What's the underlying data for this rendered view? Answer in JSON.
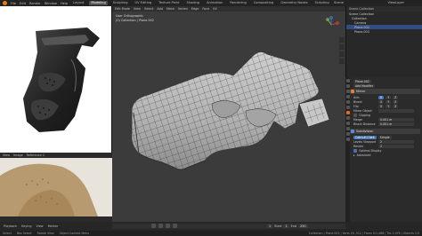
{
  "topbar": {
    "menus": [
      "File",
      "Edit",
      "Render",
      "Window",
      "Help"
    ],
    "workspaces": [
      "Layout",
      "Modeling",
      "Sculpting",
      "UV Editing",
      "Texture Paint",
      "Shading",
      "Animation",
      "Rendering",
      "Compositing",
      "Geometry Nodes",
      "Scripting"
    ],
    "active_workspace": "Modeling",
    "scene_label": "Scene",
    "viewlayer_label": "ViewLayer"
  },
  "ref_panel_bottom": {
    "header_items": [
      "View",
      "Image",
      "Reference 2"
    ]
  },
  "viewport": {
    "header_items": [
      "Edit Mode",
      "View",
      "Select",
      "Add",
      "Mesh",
      "Vertex",
      "Edge",
      "Face",
      "UV"
    ],
    "info_line1": "User Orthographic",
    "info_line2": "(0) Collection | Plane.002",
    "gizmo_axes": [
      "X",
      "Y",
      "Z"
    ]
  },
  "outliner": {
    "header": "Scene Collection",
    "rows": [
      {
        "label": "Scene Collection",
        "selected": false
      },
      {
        "label": "Collection",
        "selected": false
      },
      {
        "label": "Camera",
        "selected": false
      },
      {
        "label": "Plane.002",
        "selected": true
      },
      {
        "label": "Plane.003",
        "selected": false
      }
    ]
  },
  "properties": {
    "object_name": "Plane.002",
    "add_modifier_label": "Add Modifier",
    "modifiers": [
      {
        "name": "Mirror",
        "fields": [
          {
            "label": "Axis",
            "values": [
              "X",
              "Y",
              "Z"
            ]
          },
          {
            "label": "Bisect",
            "values": [
              "X",
              "Y",
              "Z"
            ]
          },
          {
            "label": "Flip",
            "values": [
              "X",
              "Y",
              "Z"
            ]
          },
          {
            "label": "Mirror Object",
            "values": [
              ""
            ]
          },
          {
            "label": "Clipping",
            "values": [
              ""
            ]
          },
          {
            "label": "Merge",
            "values": [
              "0.001 m"
            ]
          },
          {
            "label": "Bisect Distance",
            "values": [
              "0.001 m"
            ]
          }
        ]
      },
      {
        "name": "Subdivision",
        "mode_labels": [
          "Catmull-Clark",
          "Simple"
        ],
        "fields": [
          {
            "label": "Levels Viewport",
            "values": [
              "2"
            ]
          },
          {
            "label": "Render",
            "values": [
              "2"
            ]
          },
          {
            "label": "Optimal Display",
            "values": [
              ""
            ]
          }
        ],
        "advanced_label": "Advanced"
      }
    ]
  },
  "timeline": {
    "items": [
      "Playback",
      "Keying",
      "View",
      "Marker"
    ],
    "start_label": "Start",
    "start_value": "1",
    "end_label": "End",
    "end_value": "250",
    "current_frame": "1"
  },
  "statusbar": {
    "left_items": [
      "Select",
      "Box Select",
      "Rotate View",
      "Object Context Menu"
    ],
    "right_text": "Collection | Plane.002 | Verts 0/1,512 | Faces 0/1,488 | Tris 2,976 | Objects 1/3"
  },
  "colors": {
    "accent": "#e87d0d",
    "selection": "#334d80",
    "viewport_bg": "#3b3b3b",
    "mesh": "#b9b9b9",
    "wire": "#2a2a2a"
  }
}
